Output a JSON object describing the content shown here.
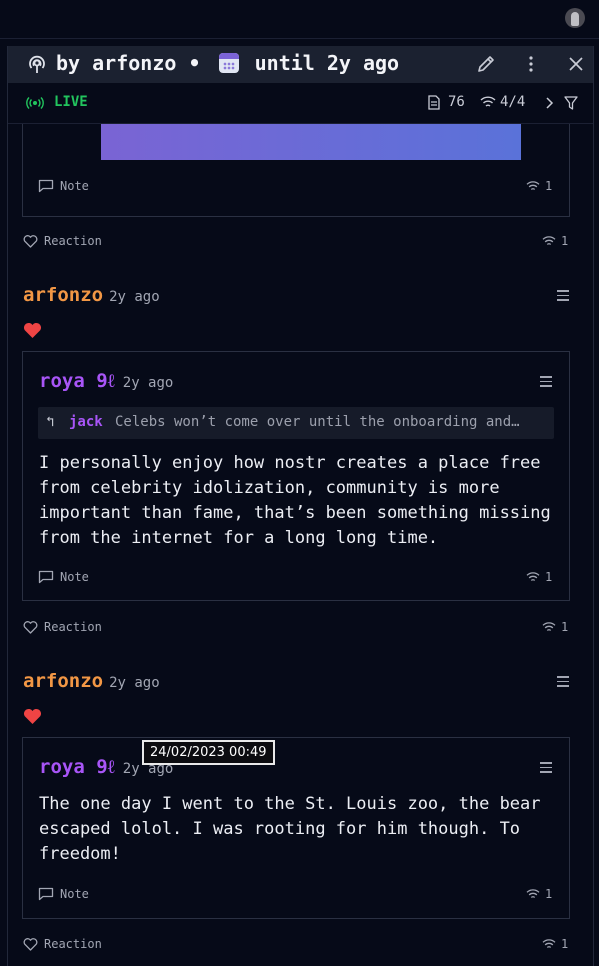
{
  "header": {
    "title_by": "by arfonzo",
    "bullet": "•",
    "title_until": "until 2y ago",
    "live_label": "LIVE",
    "note_count": "76",
    "relay_count": "4/4"
  },
  "feed": {
    "top_note": {
      "note_label": "Note",
      "zap_count": "1"
    },
    "top_reaction": {
      "label": "Reaction",
      "zap_count": "1"
    },
    "event1": {
      "author": "arfonzo",
      "time": "2y ago",
      "inner": {
        "author": "roya 9ℓ",
        "time": "2y ago",
        "reply_arrow": "↰",
        "reply_to": "jack",
        "reply_text": "Celebs won’t come over until the onboarding and…",
        "text": "I personally enjoy how nostr creates a place free from celebrity idolization, community is more important than fame, that’s been something missing from the internet for a long long time.",
        "note_label": "Note",
        "zap_count": "1"
      },
      "reaction": {
        "label": "Reaction",
        "zap_count": "1"
      }
    },
    "event2": {
      "author": "arfonzo",
      "time": "2y ago",
      "tooltip": "24/02/2023 00:49",
      "inner": {
        "author": "roya 9ℓ",
        "time": "2y ago",
        "text": "The one day I went to the St. Louis zoo, the bear escaped lolol. I was rooting for him though. To freedom!",
        "note_label": "Note",
        "zap_count": "1"
      },
      "reaction": {
        "label": "Reaction",
        "zap_count": "1"
      }
    }
  },
  "colors": {
    "background": "#060a18",
    "header_bg": "#1b2130",
    "author_orange": "#f29745",
    "author_purple": "#a855f7",
    "live_green": "#22c55e",
    "heart_red": "#ef4444"
  },
  "icons": [
    "radio-icon",
    "calendar-icon",
    "pencil-icon",
    "kebab-menu-icon",
    "close-icon",
    "live-dot-icon",
    "document-icon",
    "wifi-icon",
    "chevron-right-icon",
    "filter-icon",
    "chat-icon",
    "heart-icon",
    "menu-icon",
    "reply-arrow-icon"
  ]
}
